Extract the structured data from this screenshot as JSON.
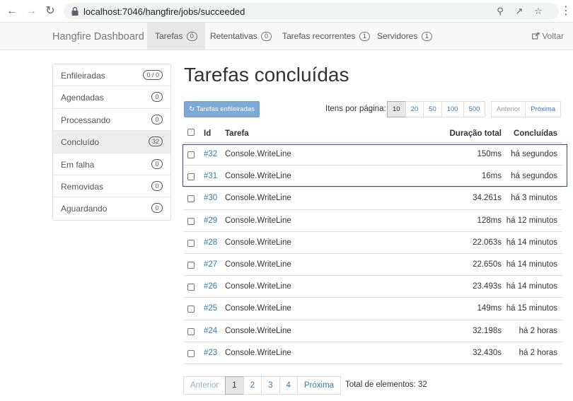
{
  "browser": {
    "url": "localhost:7046/hangfire/jobs/succeeded"
  },
  "navbar": {
    "brand": "Hangfire Dashboard",
    "items": [
      {
        "label": "Tarefas",
        "badge": "0"
      },
      {
        "label": "Retentativas",
        "badge": "0"
      },
      {
        "label": "Tarefas recorrentes",
        "badge": "1"
      },
      {
        "label": "Servidores",
        "badge": "1"
      }
    ],
    "back": "Voltar"
  },
  "sidebar": {
    "items": [
      {
        "label": "Enfileiradas",
        "badge": "0 / 0"
      },
      {
        "label": "Agendadas",
        "badge": "0"
      },
      {
        "label": "Processando",
        "badge": "0"
      },
      {
        "label": "Concluído",
        "badge": "32"
      },
      {
        "label": "Em falha",
        "badge": "0"
      },
      {
        "label": "Removidas",
        "badge": "0"
      },
      {
        "label": "Aguardando",
        "badge": "0"
      }
    ]
  },
  "main": {
    "title": "Tarefas concluídas",
    "enqueue_button": "Tarefas enfileiradas",
    "per_page_label": "Itens por página:",
    "per_page_options": [
      "10",
      "20",
      "50",
      "100",
      "500"
    ],
    "prev": "Anterior",
    "next": "Próxima"
  },
  "table": {
    "headers": {
      "id": "Id",
      "job": "Tarefa",
      "duration": "Duração total",
      "succeeded": "Concluídas"
    },
    "rows": [
      {
        "id": "#32",
        "job": "Console.WriteLine",
        "duration": "150ms",
        "succeeded": "há segundos"
      },
      {
        "id": "#31",
        "job": "Console.WriteLine",
        "duration": "16ms",
        "succeeded": "há segundos"
      },
      {
        "id": "#30",
        "job": "Console.WriteLine",
        "duration": "34.261s",
        "succeeded": "há 3 minutos"
      },
      {
        "id": "#29",
        "job": "Console.WriteLine",
        "duration": "128ms",
        "succeeded": "há 12 minutos"
      },
      {
        "id": "#28",
        "job": "Console.WriteLine",
        "duration": "22.063s",
        "succeeded": "há 14 minutos"
      },
      {
        "id": "#27",
        "job": "Console.WriteLine",
        "duration": "22.650s",
        "succeeded": "há 14 minutos"
      },
      {
        "id": "#26",
        "job": "Console.WriteLine",
        "duration": "23.493s",
        "succeeded": "há 14 minutos"
      },
      {
        "id": "#25",
        "job": "Console.WriteLine",
        "duration": "149ms",
        "succeeded": "há 15 minutos"
      },
      {
        "id": "#24",
        "job": "Console.WriteLine",
        "duration": "32.198s",
        "succeeded": "há 2 horas"
      },
      {
        "id": "#23",
        "job": "Console.WriteLine",
        "duration": "32.430s",
        "succeeded": "há 2 horas"
      }
    ]
  },
  "pagination": {
    "prev": "Anterior",
    "pages": [
      "1",
      "2",
      "3",
      "4"
    ],
    "next": "Próxima",
    "total": "Total de elementos: 32"
  }
}
